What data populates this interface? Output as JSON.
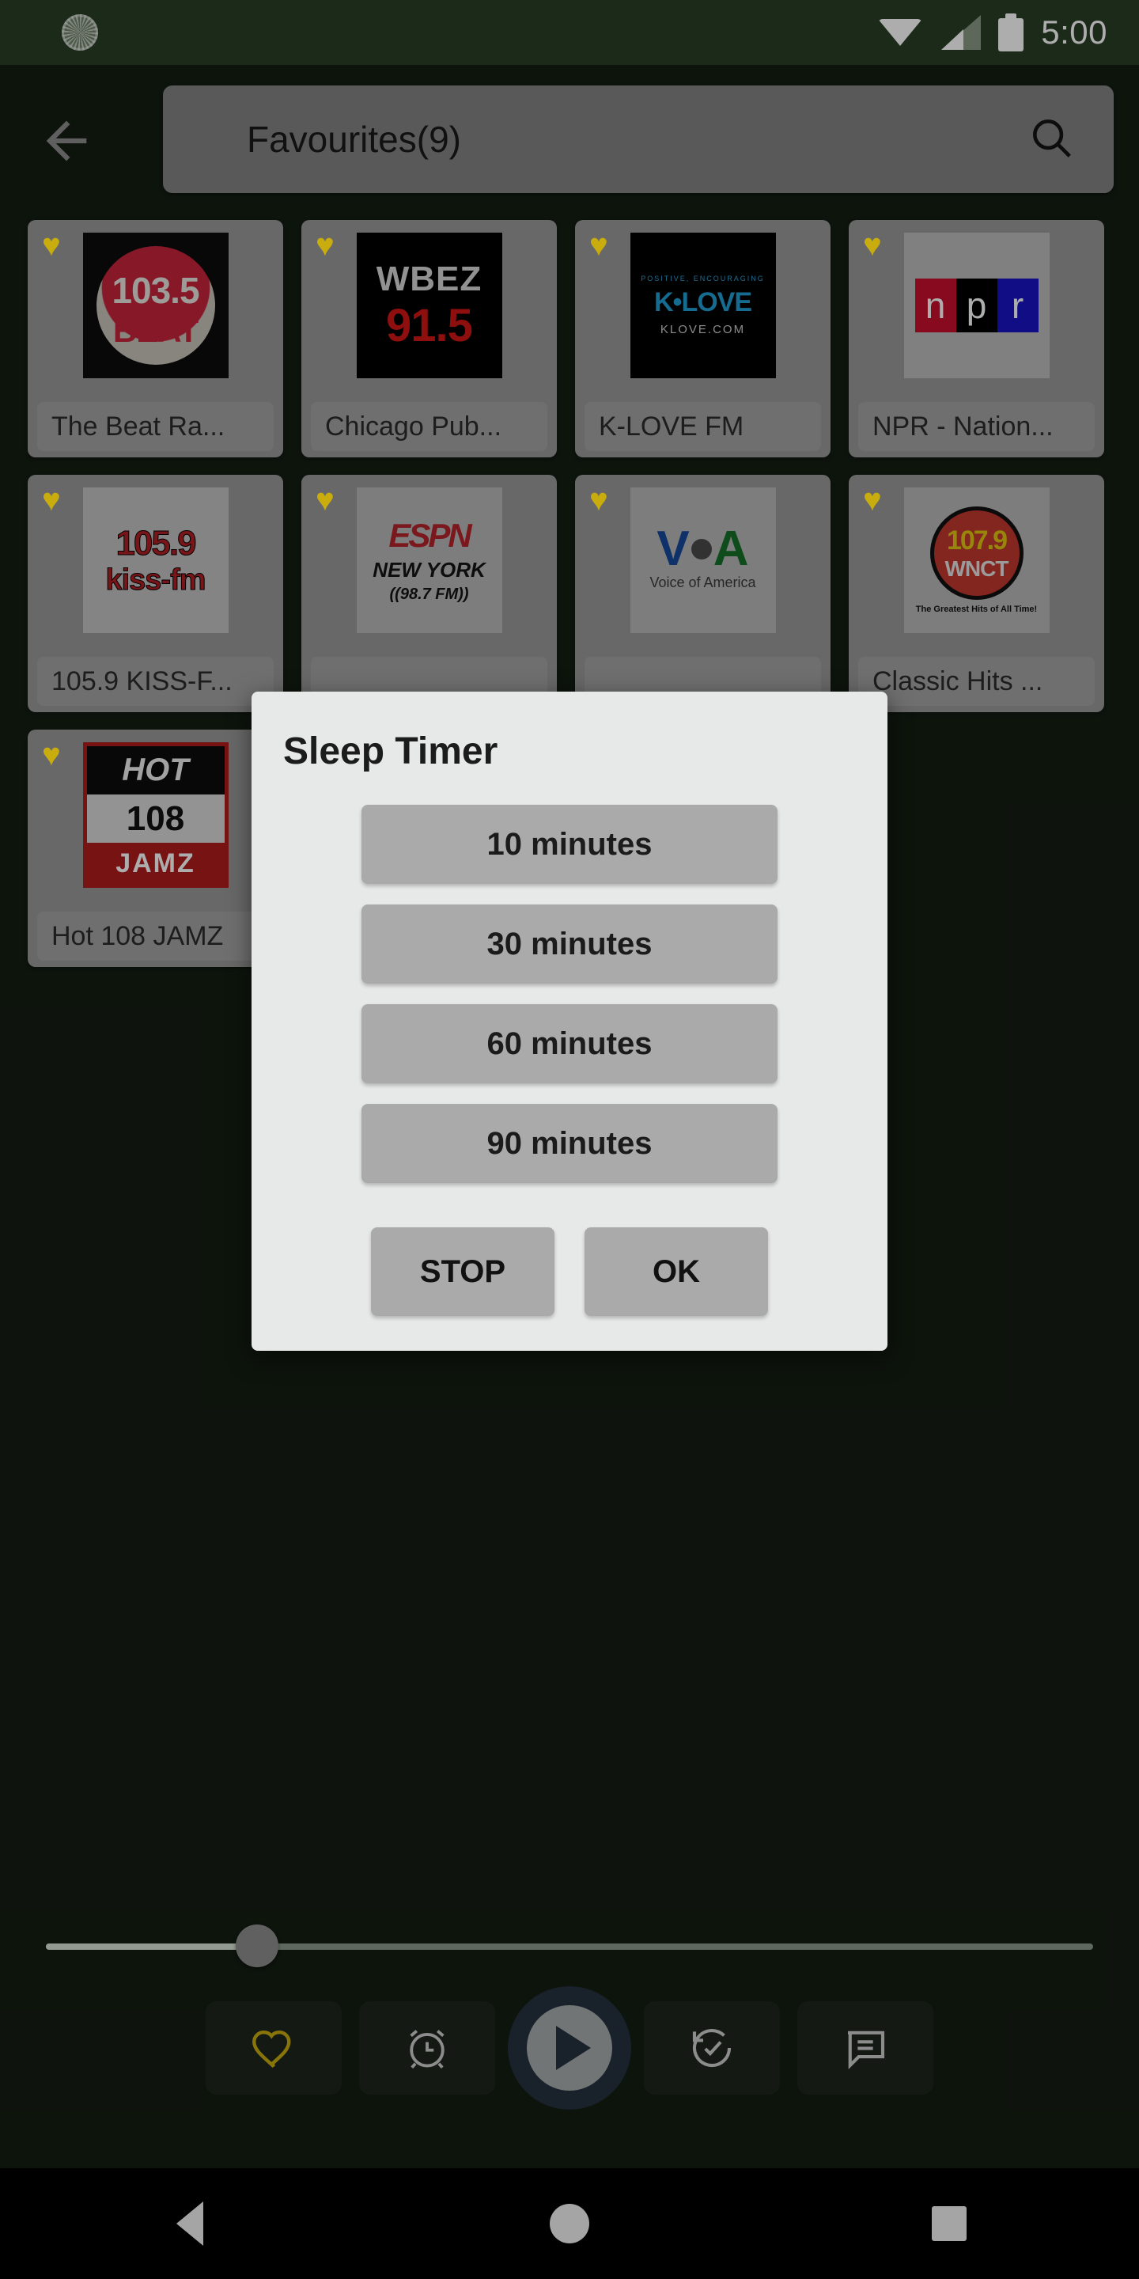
{
  "status_bar": {
    "time": "5:00",
    "icons": [
      "spinner-icon",
      "wifi-icon",
      "signal-icon",
      "battery-icon"
    ]
  },
  "toolbar": {
    "back_icon": "back-arrow-icon",
    "title": "Favourites(9)",
    "search_icon": "search-icon"
  },
  "stations": [
    {
      "name": "The Beat Ra...",
      "favourite": true,
      "logo": "103.5 THE BEAT"
    },
    {
      "name": "Chicago Pub...",
      "favourite": true,
      "logo": "WBEZ 91.5"
    },
    {
      "name": "K-LOVE FM",
      "favourite": true,
      "logo": "K-LOVE KLOVE.COM"
    },
    {
      "name": "NPR - Nation...",
      "favourite": true,
      "logo": "npr"
    },
    {
      "name": "105.9 KISS-F...",
      "favourite": true,
      "logo": "105.9 kiss-fm"
    },
    {
      "name": "",
      "favourite": true,
      "logo": "ESPN NEW YORK 98.7 FM"
    },
    {
      "name": "",
      "favourite": true,
      "logo": "VOA Voice of America"
    },
    {
      "name": "Classic Hits ...",
      "favourite": true,
      "logo": "107.9 WNCT"
    },
    {
      "name": "Hot 108 JAMZ",
      "favourite": true,
      "logo": "HOT 108 JAMZ"
    }
  ],
  "dialog": {
    "title": "Sleep Timer",
    "options": [
      "10 minutes",
      "30 minutes",
      "60 minutes",
      "90 minutes"
    ],
    "stop_label": "STOP",
    "ok_label": "OK"
  },
  "player": {
    "seek_position_percent": 20,
    "controls": [
      {
        "name": "favourite-icon",
        "active": true
      },
      {
        "name": "sleep-timer-icon",
        "active": false
      },
      {
        "name": "play-icon",
        "active": false
      },
      {
        "name": "history-icon",
        "active": false
      },
      {
        "name": "chat-icon",
        "active": false
      }
    ]
  },
  "nav_bar": {
    "items": [
      "back-nav-icon",
      "home-nav-icon",
      "recents-nav-icon"
    ]
  },
  "colors": {
    "app_background": "#141e13",
    "status_bar": "#2a3f27",
    "accent_yellow": "#c9ad0e",
    "dialog_background": "#e7e8e8",
    "button_gray": "#aaaaaa",
    "card_gray": "#9a9a9a",
    "play_button": "#26323f"
  }
}
